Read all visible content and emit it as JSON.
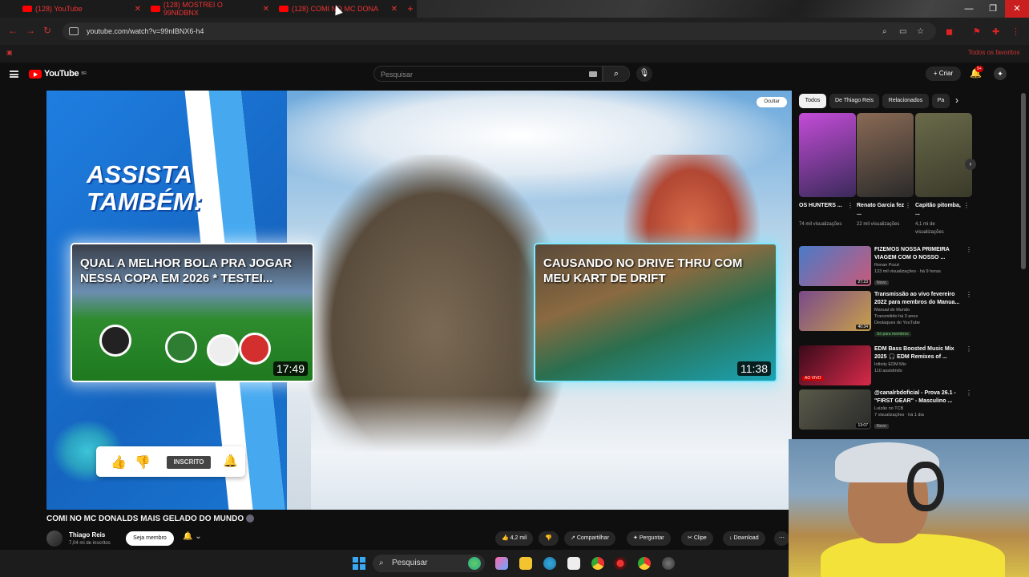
{
  "browser": {
    "tabs": [
      {
        "label": "(128) YouTube"
      },
      {
        "label": "(128) MOSTREI O 99NIDBNX"
      },
      {
        "label": "(128) COMI NO MC DONA"
      }
    ],
    "url": "youtube.com/watch?v=99nIBNX6-h4",
    "bookmarks_label": "Todos os favoritos",
    "window_controls": {
      "minimize": "—",
      "maximize": "❐",
      "close": "✕"
    }
  },
  "youtube": {
    "logo_text": "YouTube",
    "logo_region": "BR",
    "search_placeholder": "Pesquisar",
    "create_label": "+ Criar",
    "notif_count": "9+"
  },
  "video": {
    "overlay_heading": "ASSISTA TAMBÉM:",
    "end_cards": [
      {
        "title": "QUAL A MELHOR BOLA PRA JOGAR NESSA COPA EM 2026 * TESTEI...",
        "duration": "17:49"
      },
      {
        "title": "CAUSANDO NO DRIVE THRU COM MEU KART DE DRIFT",
        "duration": "11:38"
      }
    ],
    "subscribe_overlay": {
      "status": "INSCRITO"
    },
    "share_chip": "Ocultar",
    "title": "COMI NO MC DONALDS MAIS GELADO DO MUNDO",
    "channel": {
      "name": "Thiago Reis",
      "subs": "7,04 mi de inscritos",
      "join_label": "Seja membro"
    },
    "actions": [
      {
        "label": "4,2 mil",
        "icon": "👍"
      },
      {
        "label": "",
        "icon": "👎"
      },
      {
        "label": "Compartilhar",
        "icon": "↗"
      },
      {
        "label": "Perguntar",
        "icon": "✦"
      },
      {
        "label": "Clipe",
        "icon": "✂"
      },
      {
        "label": "Download",
        "icon": "↓"
      }
    ]
  },
  "sidebar": {
    "chips": [
      "Todos",
      "De Thiago Reis",
      "Relacionados",
      "Pa"
    ],
    "shorts": [
      {
        "title": "OS HUNTERS ...",
        "views": "74 mil visualizações",
        "colors": [
          "#c44cd8",
          "#3a2a5a"
        ]
      },
      {
        "title": "Renato Garcia fez ...",
        "views": "22 mil visualizações",
        "colors": [
          "#8a6a55",
          "#2a2a2a"
        ]
      },
      {
        "title": "Capitão pitomba, ...",
        "views": "4,1 mi de visualizações",
        "colors": [
          "#6a6a4a",
          "#3a3a2a"
        ]
      }
    ],
    "recommendations": [
      {
        "title": "FIZEMOS NOSSA PRIMEIRA VIAGEM COM O NOSSO ...",
        "channel": "Renan Pozzi",
        "meta": "133 mil visualizações · há 9 horas",
        "badge": "Novo",
        "duration": "27:23",
        "colors": [
          "#4a7ac8",
          "#c85a7a"
        ]
      },
      {
        "title": "Transmissão ao vivo fevereiro 2022 para membros do Manua...",
        "channel": "Manual do Mundo",
        "meta": "Transmitido há 3 anos",
        "meta2": "Destaques do YouTube",
        "badge": "Só para membros",
        "duration": "40:34",
        "colors": [
          "#7a4a8a",
          "#c8a04a"
        ]
      },
      {
        "title": "EDM Bass Boosted Music Mix 2025 🎧 EDM Remixes of ...",
        "channel": "Infinity EDM Mix",
        "meta": "110 assistindo",
        "badge": "AO VIVO",
        "duration": "",
        "colors": [
          "#3a0a1a",
          "#d82a4a"
        ]
      },
      {
        "title": "@canalrbdoficial - Prova 26.1 - \"FIRST GEAR\" - Masculino ...",
        "channel": "Luizão no TCB",
        "meta": "7 visualizações · há 1 dia",
        "badge": "Novo",
        "duration": "13:07",
        "colors": [
          "#5a5a4a",
          "#2a2a2a"
        ]
      }
    ]
  },
  "taskbar": {
    "search_label": "Pesquisar"
  }
}
